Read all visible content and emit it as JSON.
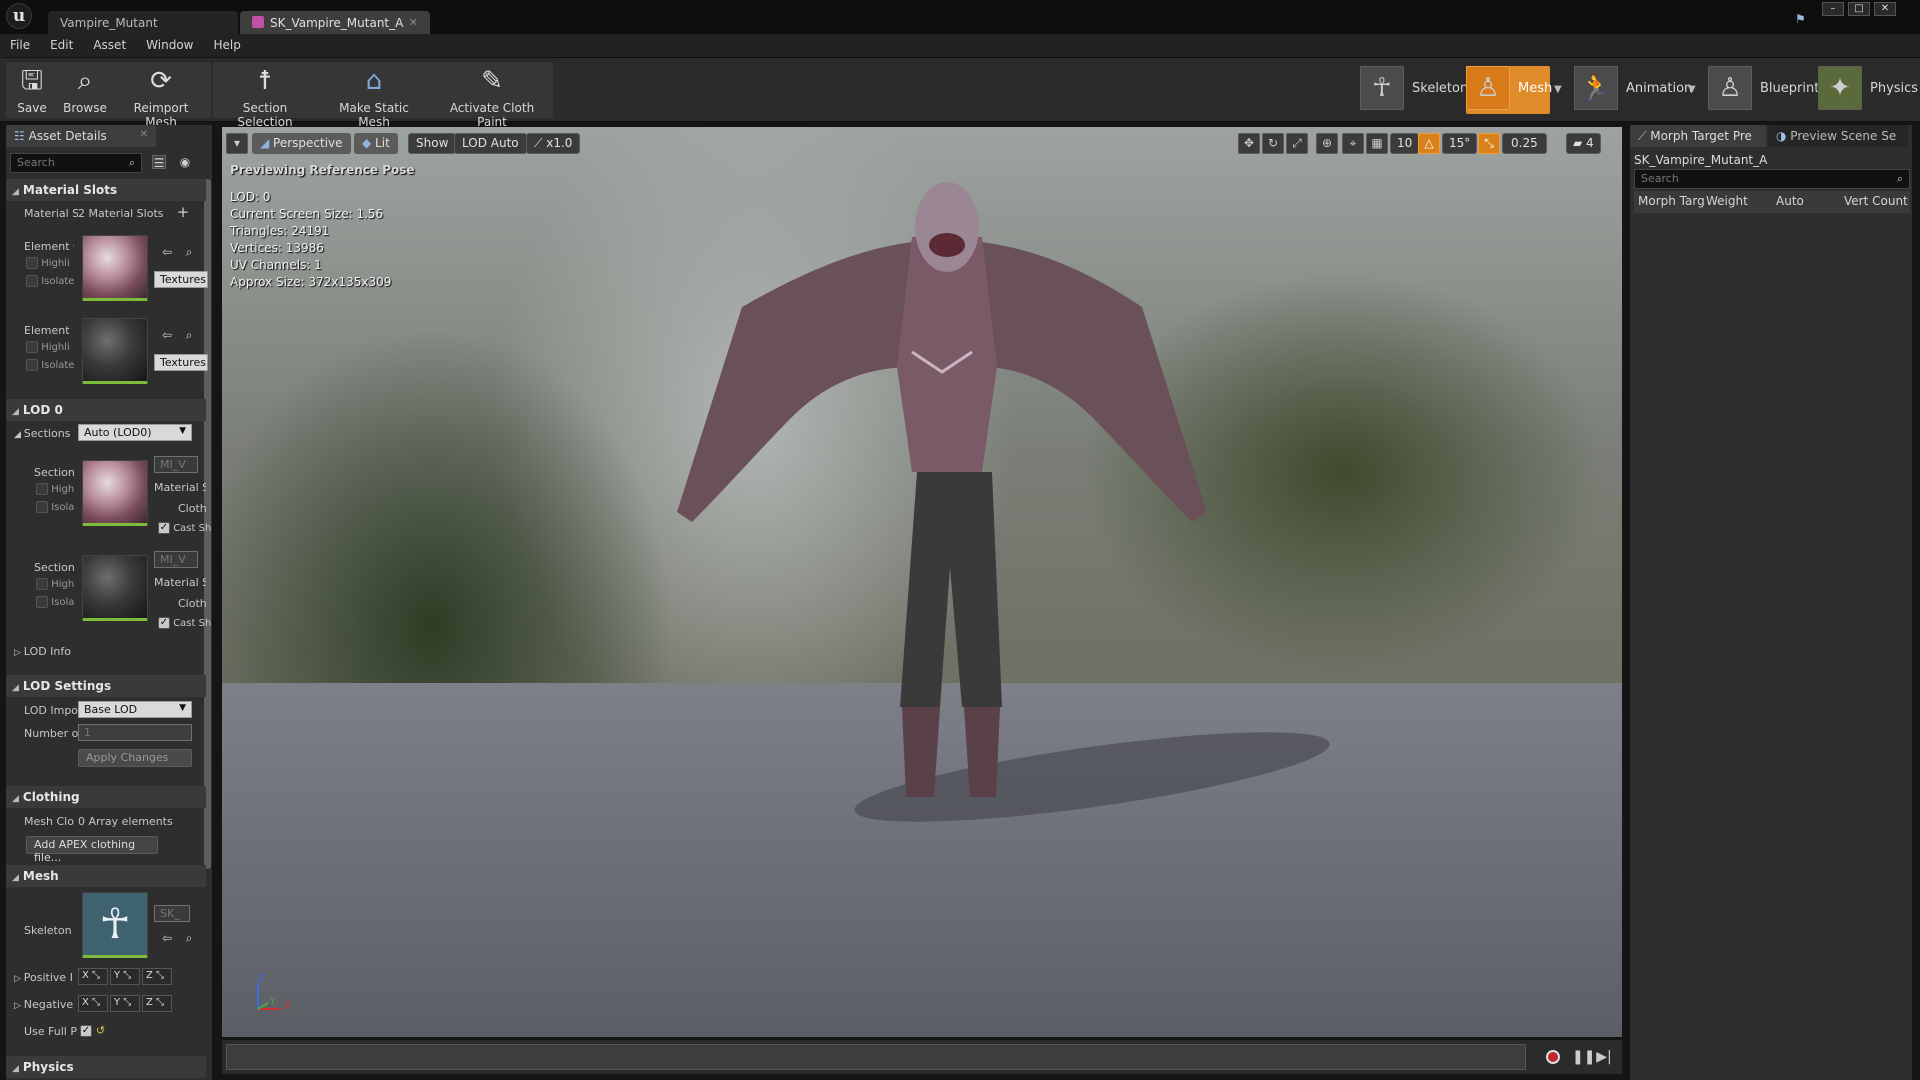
{
  "titlebar": {
    "tabs": [
      {
        "label": "Vampire_Mutant"
      },
      {
        "label": "SK_Vampire_Mutant_A"
      }
    ]
  },
  "menu": [
    "File",
    "Edit",
    "Asset",
    "Window",
    "Help"
  ],
  "toolbar": {
    "buttons": [
      {
        "label": "Save",
        "icon": "save-icon"
      },
      {
        "label": "Browse",
        "icon": "browse-icon"
      },
      {
        "label": "Reimport Mesh",
        "icon": "reimport-icon"
      },
      {
        "label": "Section Selection",
        "icon": "section-icon"
      },
      {
        "label": "Make Static Mesh",
        "icon": "static-mesh-icon"
      },
      {
        "label": "Activate Cloth Paint",
        "icon": "cloth-paint-icon"
      }
    ],
    "modes": [
      {
        "label": "Skeleton",
        "active": false
      },
      {
        "label": "Mesh",
        "active": true
      },
      {
        "label": "Animation",
        "active": false
      },
      {
        "label": "Blueprint",
        "active": false
      },
      {
        "label": "Physics",
        "active": false
      }
    ],
    "accent_color": "#e08b2a"
  },
  "left_panel": {
    "tab": "Asset Details",
    "search_placeholder": "Search",
    "material_slots": {
      "header": "Material Slots",
      "label": "Material S",
      "value": "2 Material Slots",
      "elements": [
        {
          "label": "Element 0",
          "highlight": "Highli",
          "isolate": "Isolate",
          "dropdown": "Textures"
        },
        {
          "label": "Element 1",
          "highlight": "Highli",
          "isolate": "Isolate",
          "dropdown": "Textures"
        }
      ]
    },
    "lod0": {
      "header": "LOD 0",
      "sections_label": "Sections",
      "sections_value": "Auto (LOD0)",
      "sections": [
        {
          "label": "Section",
          "mi": "MI_V",
          "high": "High",
          "isola": "Isola",
          "material": "Material Sl",
          "cloth": "Cloth",
          "cast": "Cast Sh"
        },
        {
          "label": "Section",
          "mi": "MI_V",
          "high": "High",
          "isola": "Isola",
          "material": "Material Sl",
          "cloth": "Cloth",
          "cast": "Cast Sh"
        }
      ],
      "lod_info": "LOD Info"
    },
    "lod_settings": {
      "header": "LOD Settings",
      "import_label": "LOD Impo",
      "import_value": "Base LOD",
      "number_label": "Number o",
      "number_value": "1",
      "apply_button": "Apply Changes"
    },
    "clothing": {
      "header": "Clothing",
      "mesh_label": "Mesh Clo",
      "mesh_value": "0 Array elements",
      "add_button": "Add APEX clothing file..."
    },
    "mesh": {
      "header": "Mesh",
      "skeleton_label": "Skeleton",
      "skeleton_value": "SK_",
      "positive_label": "Positive I",
      "negative_label": "Negative",
      "use_full_label": "Use Full P",
      "xyz": [
        "X",
        "Y",
        "Z"
      ]
    },
    "physics_header": "Physics"
  },
  "viewport": {
    "menu_btn": "▾",
    "perspective": "Perspective",
    "lit": "Lit",
    "show": "Show",
    "lod": "LOD Auto",
    "speed": "x1.0",
    "grid_snap": "10",
    "rot_snap": "15°",
    "scale_snap": "0.25",
    "cam_speed": "4",
    "info": {
      "pose": "Previewing Reference Pose",
      "lod": "LOD: 0",
      "screen_size": "Current Screen Size: 1.56",
      "triangles": "Triangles: 24191",
      "vertices": "Vertices: 13986",
      "uv": "UV Channels: 1",
      "size": "Approx Size: 372x135x309"
    },
    "axis": {
      "x": "X",
      "y": "Y",
      "z": "Z"
    }
  },
  "right_panel": {
    "tabs": [
      "Morph Target Pre",
      "Preview Scene Se"
    ],
    "asset_name": "SK_Vampire_Mutant_A",
    "search_placeholder": "Search",
    "columns": [
      "Morph Targ",
      "Weight",
      "Auto",
      "Vert Count"
    ]
  }
}
